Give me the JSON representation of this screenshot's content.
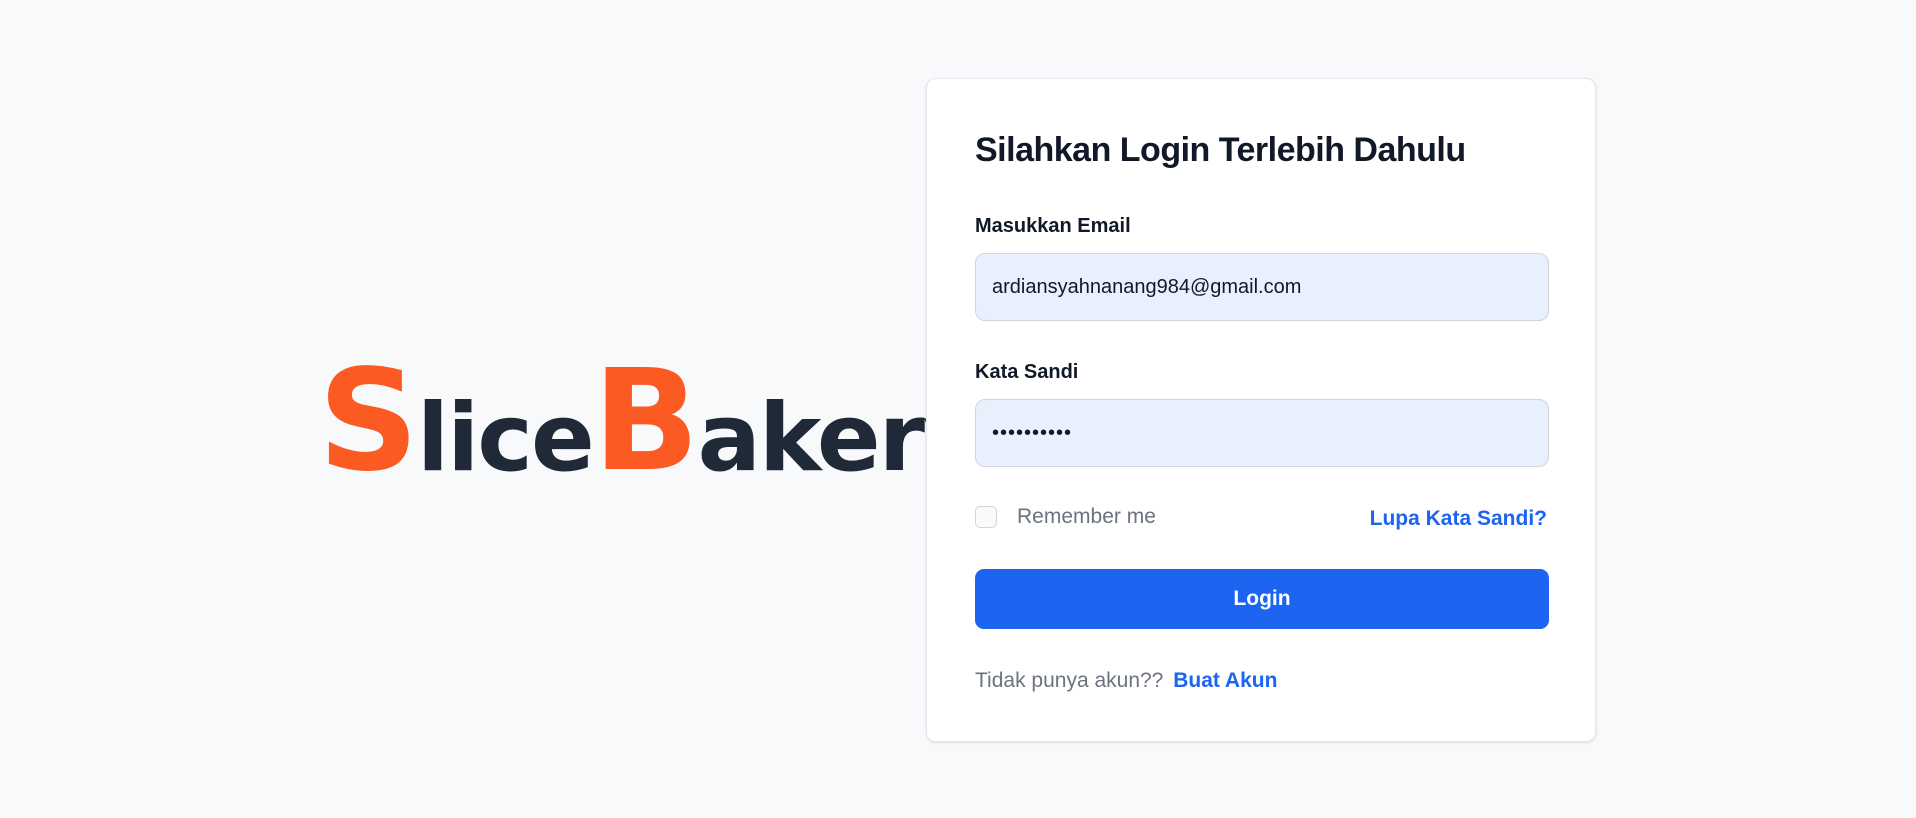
{
  "brand": {
    "initial1": "S",
    "rest1": "lice",
    "initial2": "B",
    "rest2": "akery"
  },
  "form": {
    "title": "Silahkan Login Terlebih Dahulu",
    "email_label": "Masukkan Email",
    "email_value": "ardiansyahnanang984@gmail.com",
    "password_label": "Kata Sandi",
    "password_value": "••••••••••",
    "remember_label": "Remember me",
    "remember_checked": false,
    "forgot_link": "Lupa Kata Sandi?",
    "login_button": "Login",
    "signup_prompt": "Tidak punya akun??",
    "signup_link": "Buat Akun"
  },
  "colors": {
    "brand_accent": "#fb5a22",
    "brand_dark": "#1f2937",
    "primary": "#1d64f0",
    "input_bg": "#e8f0fe",
    "page_bg": "#f8f9fb"
  }
}
